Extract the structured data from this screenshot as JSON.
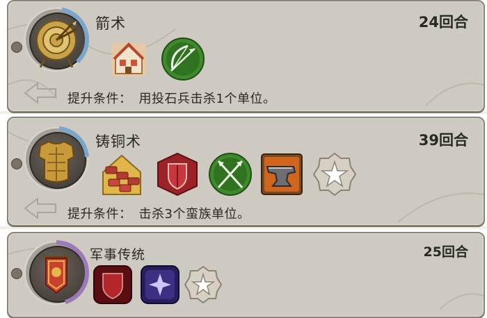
{
  "techs": [
    {
      "name": "箭术",
      "turns": "24回合",
      "condition_label": "提升条件：",
      "condition_text": "用投石兵击杀1个单位。",
      "progress": 0.35,
      "ring_color": "#7aa6c9",
      "emblem": "archery-target-icon",
      "unlocks": [
        "house-building-icon",
        "bow-arrow-icon"
      ]
    },
    {
      "name": "铸铜术",
      "turns": "39回合",
      "condition_label": "提升条件：",
      "condition_text": "击杀3个蛮族单位。",
      "progress": 0.22,
      "ring_color": "#7aa6c9",
      "emblem": "bronze-armor-icon",
      "unlocks": [
        "barracks-tiles-icon",
        "red-shield-icon",
        "crossed-spears-icon",
        "anvil-icon",
        "star-badge-icon"
      ]
    },
    {
      "name": "军事传统",
      "turns": "25回合",
      "condition_label": "",
      "condition_text": "",
      "progress": 0.45,
      "ring_color": "#9a7ab8",
      "emblem": "war-banner-icon",
      "unlocks": [
        "red-shield-card-icon",
        "purple-sparkle-card-icon",
        "star-badge-icon"
      ]
    }
  ]
}
